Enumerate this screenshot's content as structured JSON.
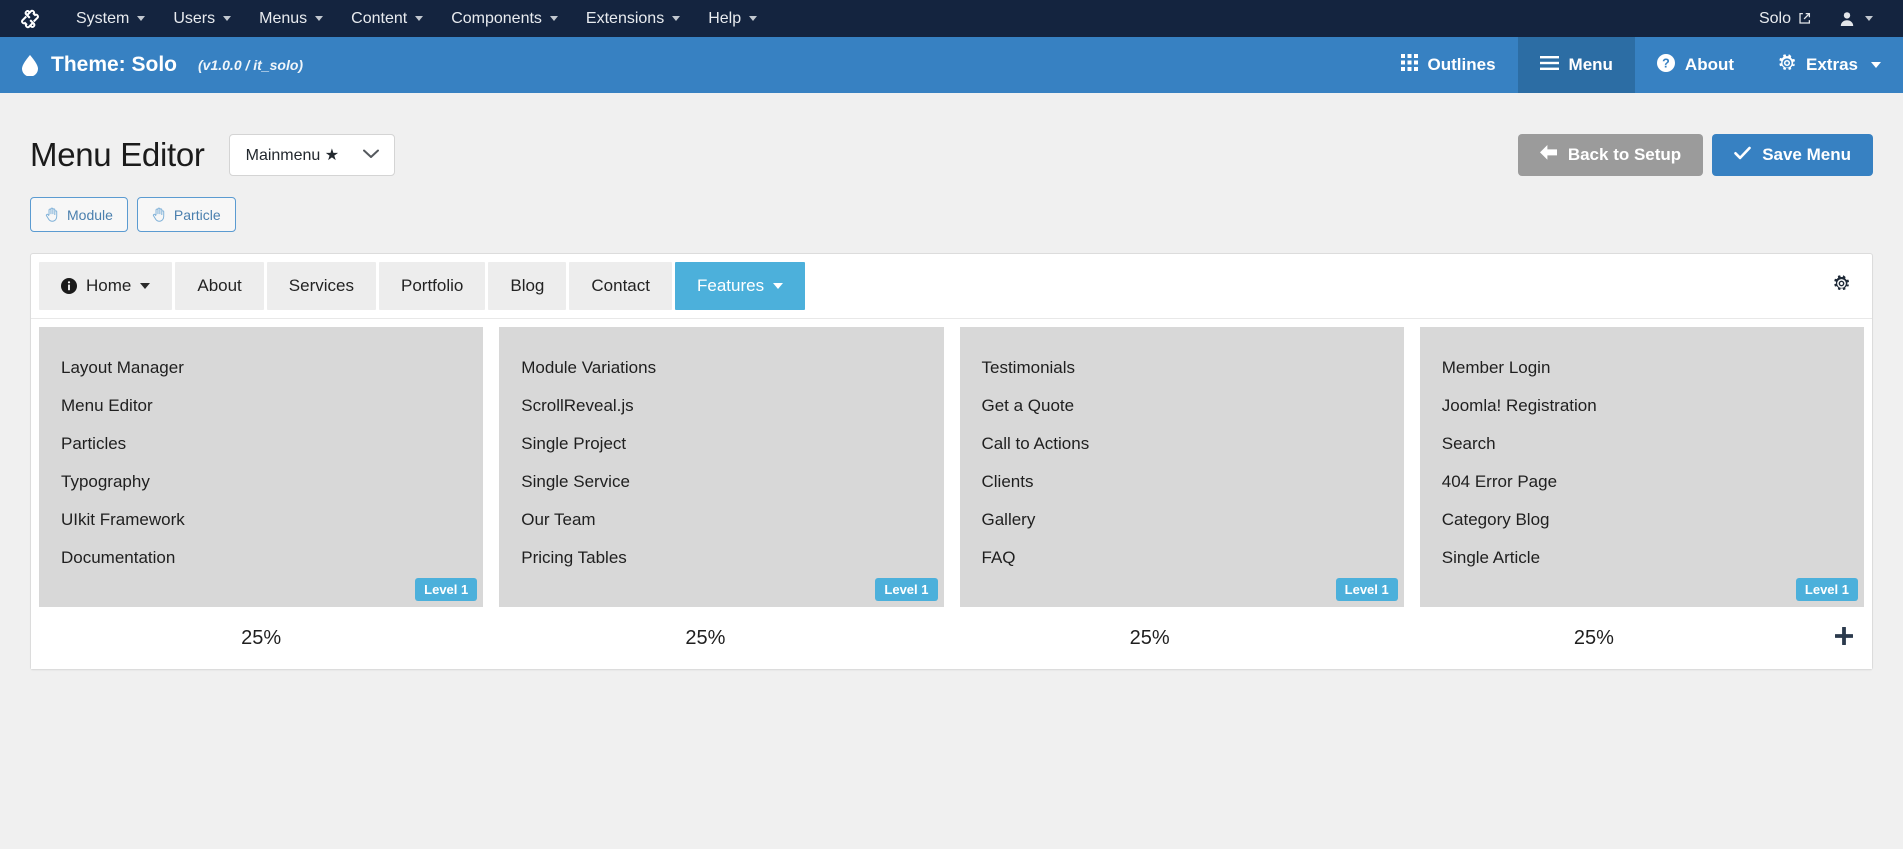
{
  "admin_bar": {
    "logo_icon": "joomla-logo-icon",
    "menus": [
      {
        "label": "System",
        "has_caret": true
      },
      {
        "label": "Users",
        "has_caret": true
      },
      {
        "label": "Menus",
        "has_caret": true
      },
      {
        "label": "Content",
        "has_caret": true
      },
      {
        "label": "Components",
        "has_caret": true
      },
      {
        "label": "Extensions",
        "has_caret": true
      },
      {
        "label": "Help",
        "has_caret": true
      }
    ],
    "site_link_label": "Solo",
    "site_link_icon": "external-link-icon",
    "user_icon": "user-icon"
  },
  "theme_bar": {
    "icon": "droplet-icon",
    "title": "Theme: Solo",
    "version": "(v1.0.0 / it_solo)",
    "nav": [
      {
        "label": "Outlines",
        "icon": "grid-icon",
        "active": false
      },
      {
        "label": "Menu",
        "icon": "hamburger-icon",
        "active": true
      },
      {
        "label": "About",
        "icon": "question-circle-icon",
        "active": false
      },
      {
        "label": "Extras",
        "icon": "gear-icon",
        "active": false,
        "has_caret": true
      }
    ],
    "background_color": "#3781c2",
    "active_color": "#2c6da4"
  },
  "header": {
    "page_title": "Menu Editor",
    "menu_selector": {
      "selected": "Mainmenu ★",
      "options": [
        "Mainmenu ★"
      ]
    },
    "back_button": {
      "label": "Back to Setup",
      "icon": "arrow-left-icon",
      "color": "#9b9b9b"
    },
    "save_button": {
      "label": "Save Menu",
      "icon": "check-icon",
      "color": "#3781c2"
    }
  },
  "pickers": [
    {
      "label": "Module",
      "icon": "hand-grab-icon"
    },
    {
      "label": "Particle",
      "icon": "hand-grab-icon"
    }
  ],
  "menu_tabs": [
    {
      "label": "Home",
      "icon": "info-circle-icon",
      "has_caret": true,
      "active": false
    },
    {
      "label": "About",
      "icon": null,
      "has_caret": false,
      "active": false
    },
    {
      "label": "Services",
      "icon": null,
      "has_caret": false,
      "active": false
    },
    {
      "label": "Portfolio",
      "icon": null,
      "has_caret": false,
      "active": false
    },
    {
      "label": "Blog",
      "icon": null,
      "has_caret": false,
      "active": false
    },
    {
      "label": "Contact",
      "icon": null,
      "has_caret": false,
      "active": false
    },
    {
      "label": "Features",
      "icon": null,
      "has_caret": true,
      "active": true
    }
  ],
  "tab_settings_icon": "gear-icon",
  "columns": [
    {
      "items": [
        "Layout Manager",
        "Menu Editor",
        "Particles",
        "Typography",
        "UIkit Framework",
        "Documentation"
      ],
      "level_badge": "Level 1",
      "width_percent": "25%"
    },
    {
      "items": [
        "Module Variations",
        "ScrollReveal.js",
        "Single Project",
        "Single Service",
        "Our Team",
        "Pricing Tables"
      ],
      "level_badge": "Level 1",
      "width_percent": "25%"
    },
    {
      "items": [
        "Testimonials",
        "Get a Quote",
        "Call to Actions",
        "Clients",
        "Gallery",
        "FAQ"
      ],
      "level_badge": "Level 1",
      "width_percent": "25%"
    },
    {
      "items": [
        "Member Login",
        "Joomla! Registration",
        "Search",
        "404 Error Page",
        "Category Blog",
        "Single Article"
      ],
      "level_badge": "Level 1",
      "width_percent": "25%"
    }
  ],
  "add_column_icon": "plus-icon",
  "colors": {
    "admin_bar": "#14243f",
    "theme_blue": "#3781c2",
    "accent_light_blue": "#4cb0db",
    "page_background": "#f0f0f0",
    "column_background": "#d8d8d8",
    "tab_background": "#ededed"
  }
}
